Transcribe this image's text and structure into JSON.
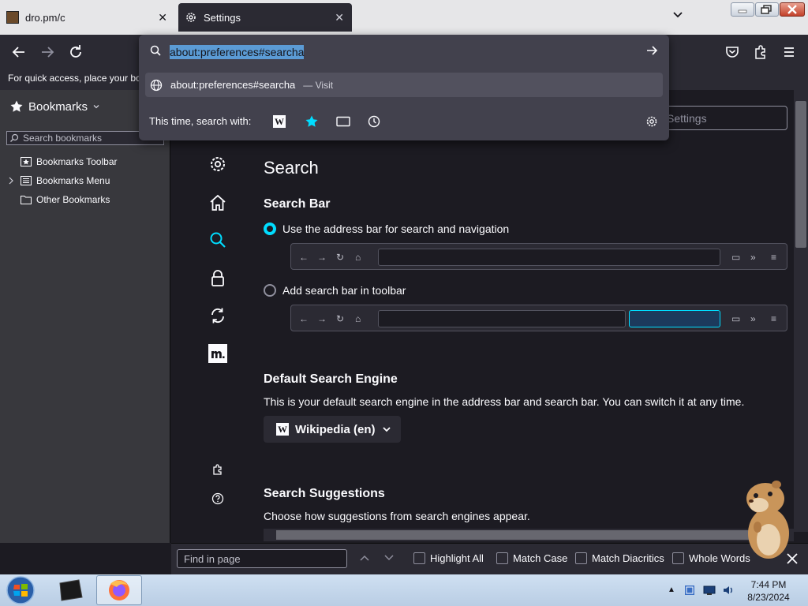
{
  "tabs": [
    {
      "title": "dro.pm/c",
      "active": false
    },
    {
      "title": "Settings",
      "active": true
    }
  ],
  "urlbar": {
    "value": "about:preferences#searcha",
    "suggestion": "about:preferences#searcha",
    "suggestion_suffix": "— Visit",
    "oneoff_label": "This time, search with:"
  },
  "bookmarks_toolbar_hint": "For quick access, place your boo",
  "sidebar": {
    "title": "Bookmarks",
    "search_placeholder": "Search bookmarks",
    "items": [
      {
        "label": "Bookmarks Toolbar"
      },
      {
        "label": "Bookmarks Menu"
      },
      {
        "label": "Other Bookmarks"
      }
    ]
  },
  "prefs": {
    "find_placeholder": "Settings",
    "title": "Search",
    "search_bar_heading": "Search Bar",
    "radio1": "Use the address bar for search and navigation",
    "radio2": "Add search bar in toolbar",
    "default_engine_heading": "Default Search Engine",
    "default_engine_desc": "This is your default search engine in the address bar and search bar. You can switch it at any time.",
    "engine": "Wikipedia (en)",
    "suggestions_heading": "Search Suggestions",
    "suggestions_desc": "Choose how suggestions from search engines appear."
  },
  "findbar": {
    "placeholder": "Find in page",
    "highlight_all": "Highlight All",
    "match_case": "Match Case",
    "match_diacritics": "Match Diacritics",
    "whole_words": "Whole Words"
  },
  "taskbar": {
    "time": "7:44 PM",
    "date": "8/23/2024"
  },
  "colors": {
    "accent": "#00ddff",
    "selection": "#5b9bd5"
  }
}
